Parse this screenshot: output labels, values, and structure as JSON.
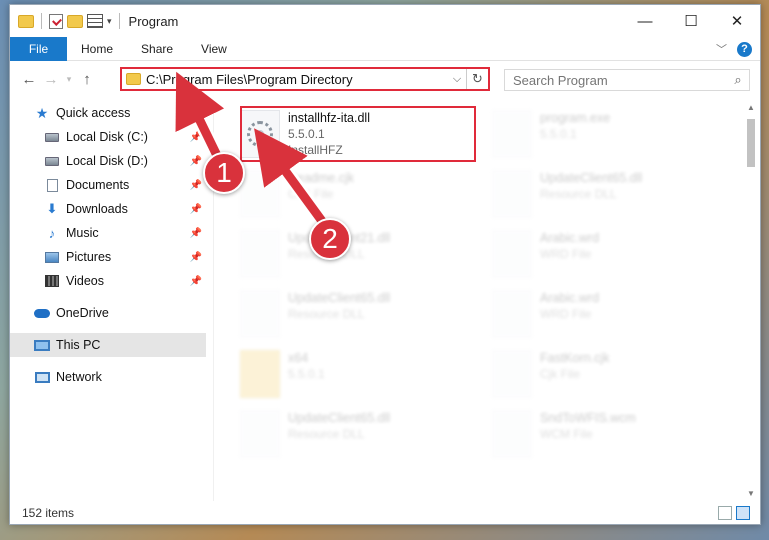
{
  "window": {
    "title": "Program",
    "controls": {
      "minimize": "—",
      "maximize": "☐",
      "close": "✕"
    }
  },
  "ribbon": {
    "tabs": [
      "File",
      "Home",
      "Share",
      "View"
    ],
    "help": "?"
  },
  "nav": {
    "address": "C:\\Program Files\\Program Directory",
    "search_placeholder": "Search Program"
  },
  "sidebar": {
    "quick_access": "Quick access",
    "items": [
      "Local Disk (C:)",
      "Local Disk (D:)",
      "Documents",
      "Downloads",
      "Music",
      "Pictures",
      "Videos"
    ],
    "onedrive": "OneDrive",
    "this_pc": "This PC",
    "network": "Network"
  },
  "files": {
    "highlighted": {
      "name": "installhfz-ita.dll",
      "version": "5.5.0.1",
      "company": "InstallHFZ"
    },
    "background": [
      {
        "name": "program.exe",
        "sub": "5.5.0.1"
      },
      {
        "name": "Readme.cjk",
        "sub": "CJK File"
      },
      {
        "name": "UpdateClient65.dll",
        "sub": "Resource DLL"
      },
      {
        "name": "UpdateClient21.dll",
        "sub": "Resource DLL"
      },
      {
        "name": "Arabic.wrd",
        "sub": "WRD File"
      },
      {
        "name": "UpdateClient65.dll",
        "sub": "Resource DLL"
      },
      {
        "name": "Arabic.wrd",
        "sub": "WRD File"
      },
      {
        "name": "x64",
        "sub": "5.5.0.1"
      },
      {
        "name": "FastKorn.cjk",
        "sub": "Cjk File"
      },
      {
        "name": "UpdateClient65.dll",
        "sub": "Resource DLL"
      },
      {
        "name": "SndToWFIS.wcm",
        "sub": "WCM File"
      }
    ]
  },
  "status": {
    "count": "152 items"
  },
  "annotations": {
    "step1": "1",
    "step2": "2"
  },
  "colors": {
    "accent": "#1979ca",
    "highlight": "#e02a3a"
  }
}
